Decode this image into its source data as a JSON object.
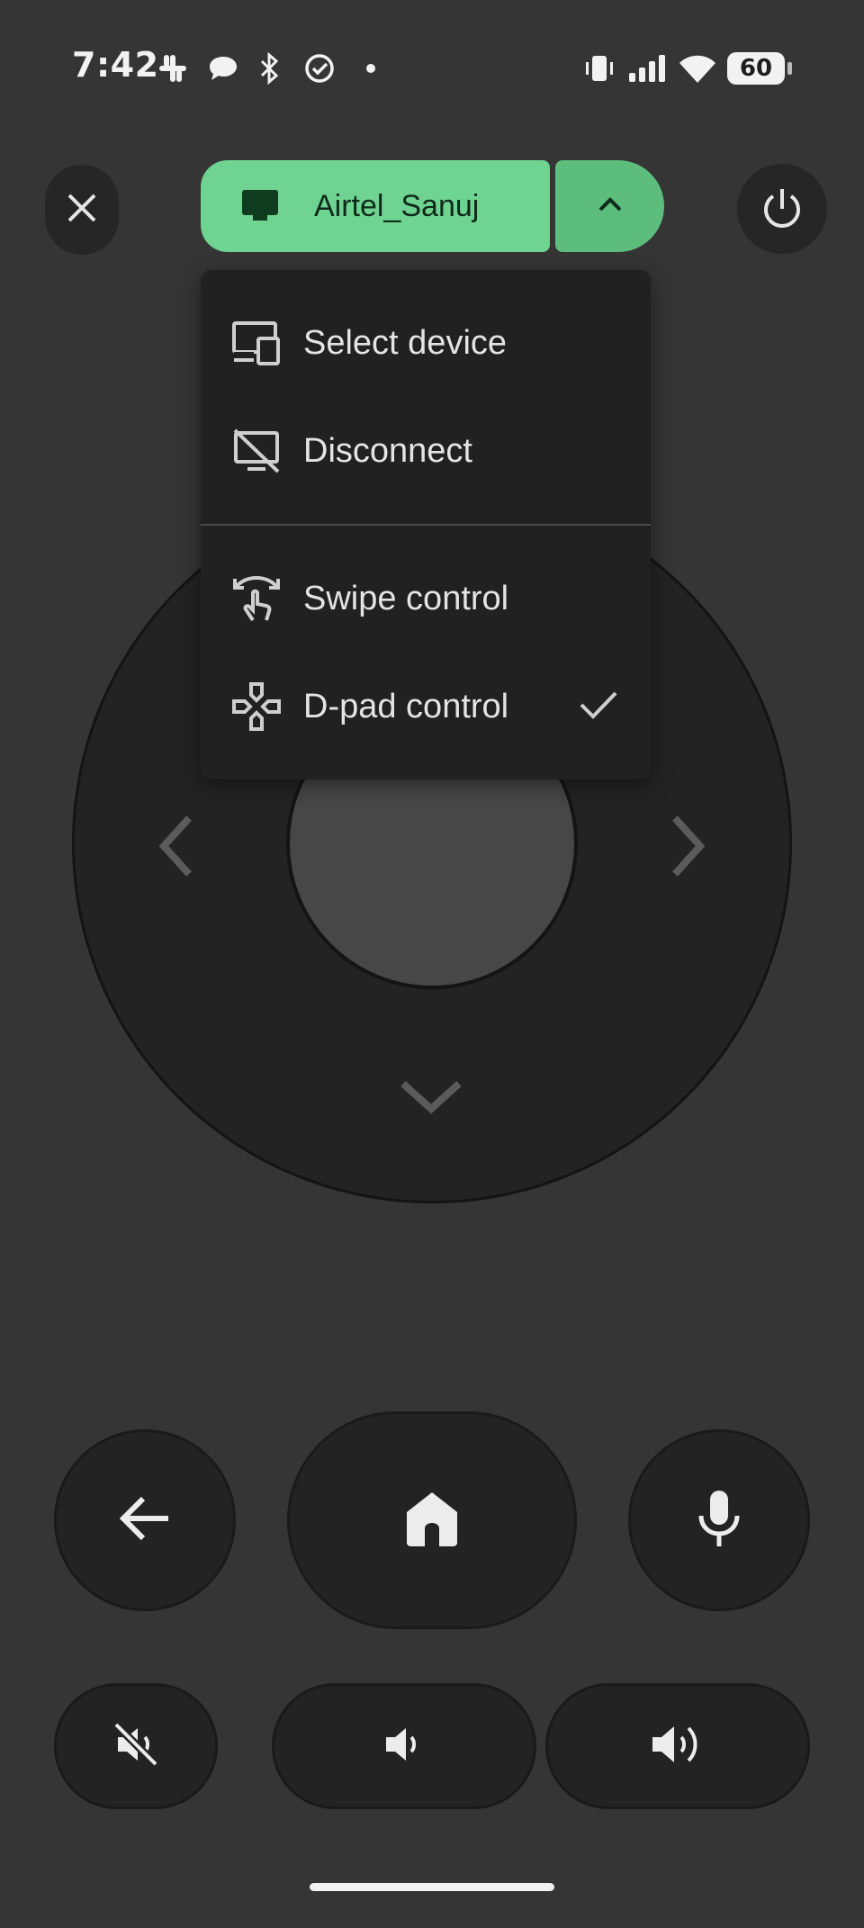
{
  "status_bar": {
    "time": "7:42",
    "battery": "60",
    "icons": [
      "slack-icon",
      "chat-bubble-icon",
      "bluetooth-icon",
      "check-circle-icon",
      "dot-icon",
      "vibrate-icon",
      "signal-icon",
      "wifi-icon",
      "battery-icon"
    ]
  },
  "header": {
    "close_icon": "close-icon",
    "device_name": "Airtel_Sanuj",
    "device_icon": "tv-icon",
    "expand_icon": "chevron-up-icon",
    "power_icon": "power-icon",
    "accent_color": "#6fd392"
  },
  "menu": {
    "items": [
      {
        "label": "Select device",
        "icon": "devices-icon"
      },
      {
        "label": "Disconnect",
        "icon": "cast-off-icon"
      },
      {
        "label": "Swipe control",
        "icon": "swipe-icon"
      },
      {
        "label": "D-pad control",
        "icon": "gamepad-icon",
        "checked": true
      }
    ]
  },
  "dpad": {
    "left_icon": "chevron-left-icon",
    "right_icon": "chevron-right-icon",
    "down_icon": "chevron-down-icon"
  },
  "controls": {
    "back_icon": "arrow-back-icon",
    "home_icon": "home-icon",
    "mic_icon": "mic-icon",
    "mute_icon": "volume-off-icon",
    "volume_down_icon": "volume-down-icon",
    "volume_up_icon": "volume-up-icon"
  }
}
